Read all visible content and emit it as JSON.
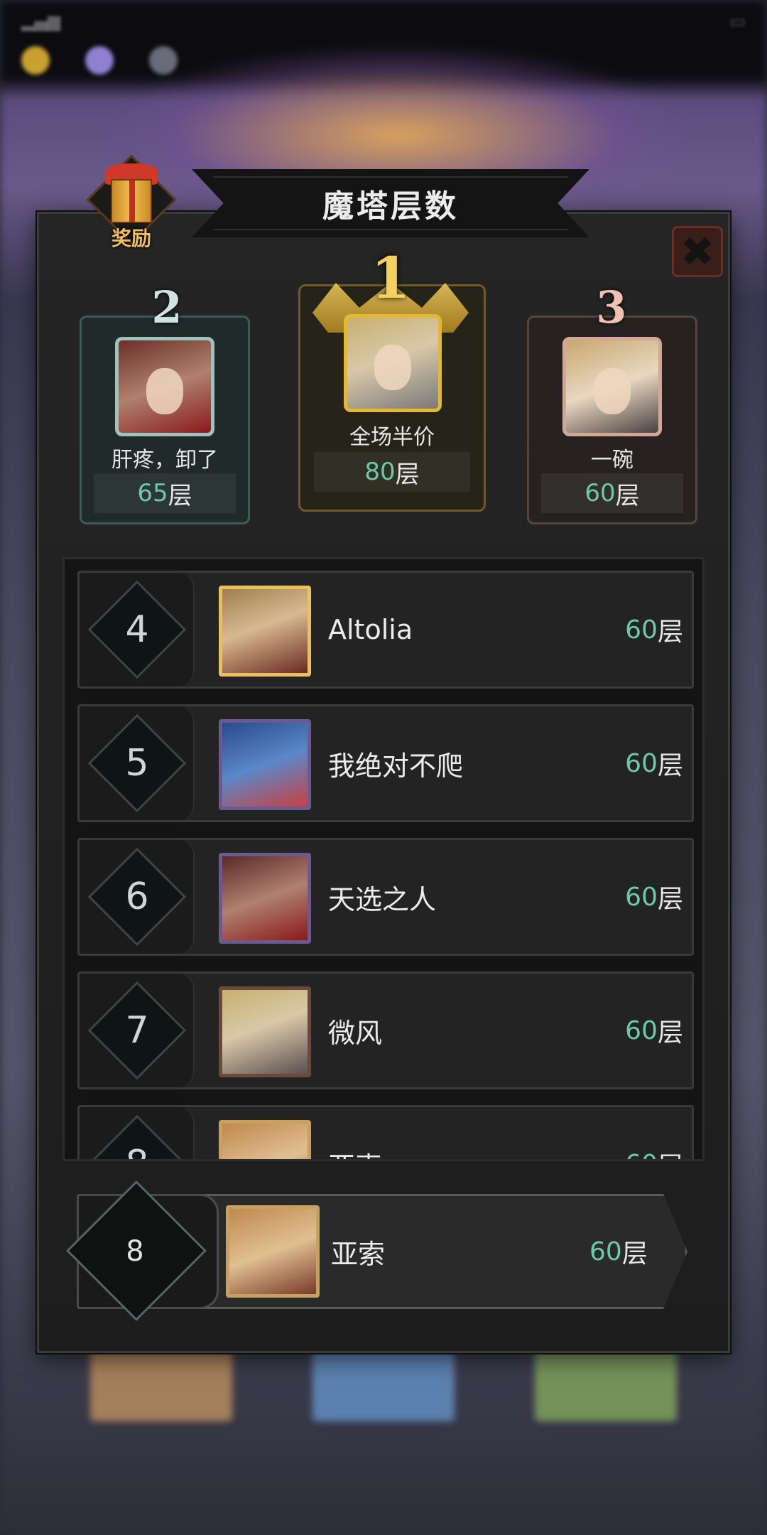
{
  "window": {
    "title": "魔塔层数"
  },
  "reward_button": {
    "label": "奖励"
  },
  "close_button": {
    "icon": "close-icon"
  },
  "score_unit": "层",
  "podium": [
    {
      "rank": "2",
      "name": "肝疼，卸了",
      "score": "65"
    },
    {
      "rank": "1",
      "name": "全场半价",
      "score": "80"
    },
    {
      "rank": "3",
      "name": "一碗",
      "score": "60"
    }
  ],
  "rows": [
    {
      "rank": "4",
      "name": "Altolia",
      "score": "60"
    },
    {
      "rank": "5",
      "name": "我绝对不爬",
      "score": "60"
    },
    {
      "rank": "6",
      "name": "天选之人",
      "score": "60"
    },
    {
      "rank": "7",
      "name": "微风",
      "score": "60"
    },
    {
      "rank": "8",
      "name": "亚索",
      "score": "60"
    }
  ],
  "my_rank": {
    "rank": "8",
    "name": "亚索",
    "score": "60"
  },
  "colors": {
    "score_green": "#6ccaa8",
    "gold": "#f4d060",
    "silver": "#cfe4e0",
    "bronze": "#f0c0b0",
    "close_red": "#3a1e1a"
  }
}
